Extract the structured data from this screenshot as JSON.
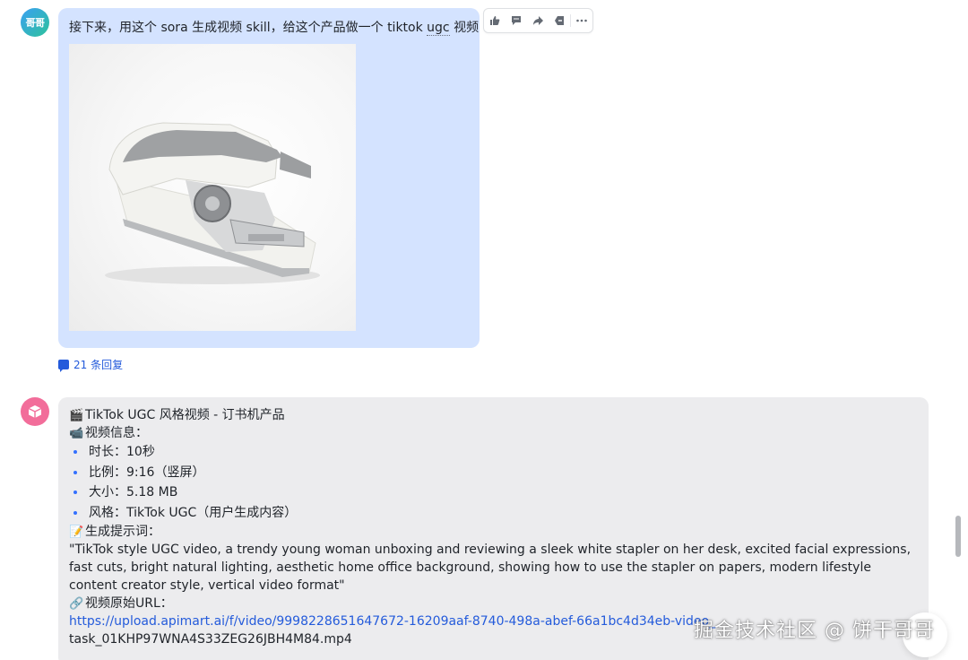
{
  "user_message": {
    "avatar_text": "哥哥",
    "text_before_ugc": "接下来，用这个 sora 生成视频 skill，给这个产品做一个 tiktok ",
    "text_ugc": "ugc",
    "text_after_ugc": " 视频",
    "replies_label": "21 条回复"
  },
  "toolbar": {
    "icons": [
      "thumbs-up-icon",
      "comment-icon",
      "forward-icon",
      "pin-icon",
      "more-icon"
    ]
  },
  "bot_message": {
    "title": "TikTok UGC 风格视频 - 订书机产品",
    "title_emoji": "🎬",
    "info_emoji": "📹",
    "info_heading": "视频信息：",
    "info_items": [
      "时长：10秒",
      "比例：9:16（竖屏）",
      "大小：5.18 MB",
      "风格：TikTok UGC（用户生成内容）"
    ],
    "prompt_emoji": "📝",
    "prompt_heading": "生成提示词：",
    "prompt_text": "\"TikTok style UGC video, a trendy young woman unboxing and reviewing a sleek white stapler on her desk, excited facial expressions, fast cuts, bright natural lighting, aesthetic home office background, showing how to use the stapler on papers, modern lifestyle content creator style, vertical video format\"",
    "url_emoji": "🔗",
    "url_heading": "视频原始URL：",
    "url_text": "https://upload.apimart.ai/f/video/9998228651647672-16209aaf-8740-498a-abef-66a1bc4d34eb-video_",
    "file_name": "task_01KHP97WNA4S33ZEG26JBH4M84.mp4"
  },
  "watermark": "掘金技术社区 @ 饼干哥哥",
  "colors": {
    "user_bubble": "#d4e3ff",
    "bot_bubble": "#ececee",
    "link": "#245bdb",
    "bullet": "#3370ff"
  }
}
